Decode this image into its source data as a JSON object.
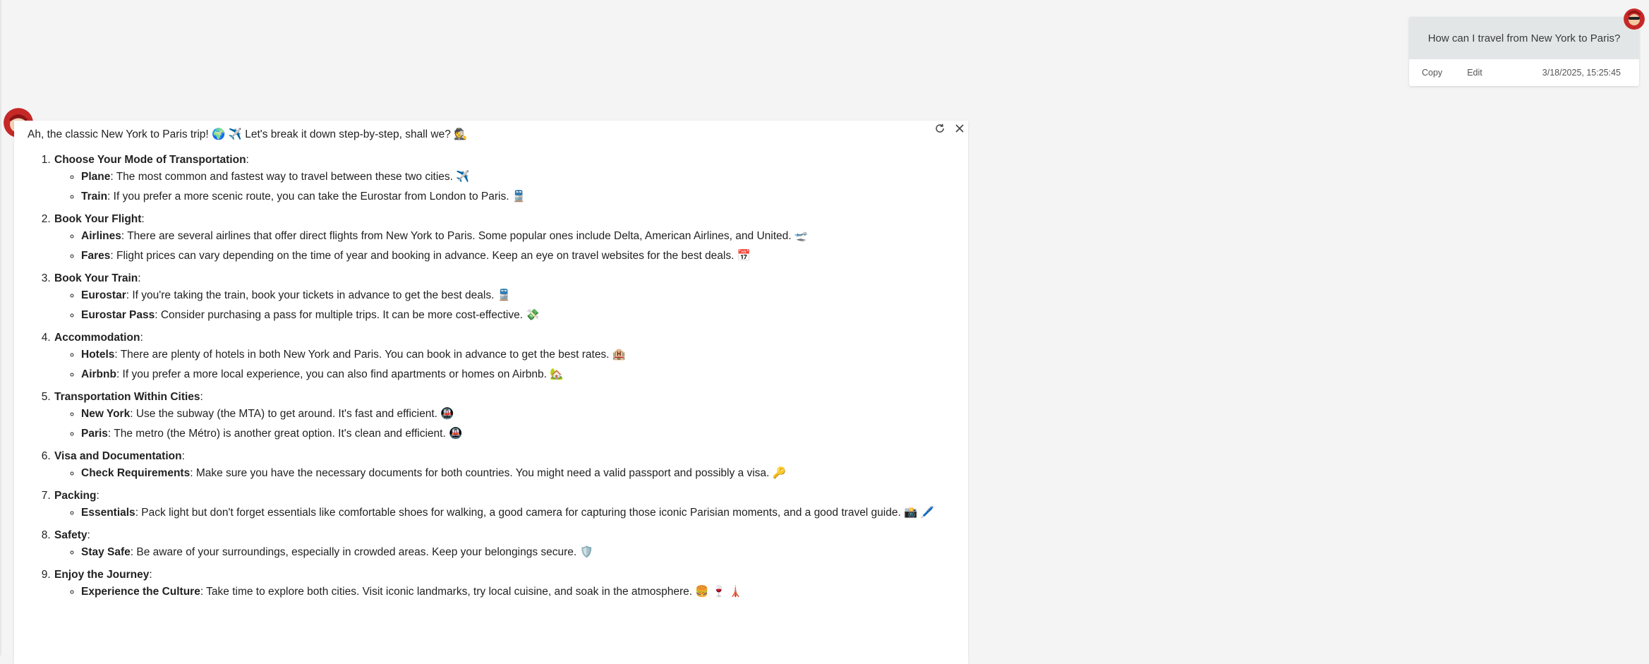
{
  "user_message": {
    "text": "How can I travel from New York to Paris?",
    "copy_label": "Copy",
    "edit_label": "Edit",
    "timestamp": "3/18/2025, 15:25:45"
  },
  "assistant": {
    "intro": "Ah, the classic New York to Paris trip! 🌍 ✈️ Let's break it down step-by-step, shall we? 🕵️",
    "steps": [
      {
        "title": "Choose Your Mode of Transportation",
        "items": [
          {
            "label": "Plane",
            "text": ": The most common and fastest way to travel between these two cities. ✈️"
          },
          {
            "label": "Train",
            "text": ": If you prefer a more scenic route, you can take the Eurostar from London to Paris. 🚆"
          }
        ]
      },
      {
        "title": "Book Your Flight",
        "items": [
          {
            "label": "Airlines",
            "text": ": There are several airlines that offer direct flights from New York to Paris. Some popular ones include Delta, American Airlines, and United. 🛫"
          },
          {
            "label": "Fares",
            "text": ": Flight prices can vary depending on the time of year and booking in advance. Keep an eye on travel websites for the best deals. 📅"
          }
        ]
      },
      {
        "title": "Book Your Train",
        "items": [
          {
            "label": "Eurostar",
            "text": ": If you're taking the train, book your tickets in advance to get the best deals. 🚆"
          },
          {
            "label": "Eurostar Pass",
            "text": ": Consider purchasing a pass for multiple trips. It can be more cost-effective. 💸"
          }
        ]
      },
      {
        "title": "Accommodation",
        "items": [
          {
            "label": "Hotels",
            "text": ": There are plenty of hotels in both New York and Paris. You can book in advance to get the best rates. 🏨"
          },
          {
            "label": "Airbnb",
            "text": ": If you prefer a more local experience, you can also find apartments or homes on Airbnb. 🏡"
          }
        ]
      },
      {
        "title": "Transportation Within Cities",
        "items": [
          {
            "label": "New York",
            "text": ": Use the subway (the MTA) to get around. It's fast and efficient. 🚇"
          },
          {
            "label": "Paris",
            "text": ": The metro (the Métro) is another great option. It's clean and efficient. 🚇"
          }
        ]
      },
      {
        "title": "Visa and Documentation",
        "items": [
          {
            "label": "Check Requirements",
            "text": ": Make sure you have the necessary documents for both countries. You might need a valid passport and possibly a visa. 🔑"
          }
        ]
      },
      {
        "title": "Packing",
        "items": [
          {
            "label": "Essentials",
            "text": ": Pack light but don't forget essentials like comfortable shoes for walking, a good camera for capturing those iconic Parisian moments, and a good travel guide. 📸 🖊️"
          }
        ]
      },
      {
        "title": "Safety",
        "items": [
          {
            "label": "Stay Safe",
            "text": ": Be aware of your surroundings, especially in crowded areas. Keep your belongings secure. 🛡️"
          }
        ]
      },
      {
        "title": "Enjoy the Journey",
        "items": [
          {
            "label": "Experience the Culture",
            "text": ": Take time to explore both cities. Visit iconic landmarks, try local cuisine, and soak in the atmosphere. 🍔 🍷 🗼"
          }
        ]
      }
    ]
  },
  "colors": {
    "page_background": "#f4f4f4",
    "user_bubble": "#e3e6e7",
    "avatar_red": "#c62828"
  },
  "icons": {
    "regenerate": "refresh-icon",
    "close": "close-icon",
    "user_avatar": "avatar-icon",
    "bot_avatar": "avatar-icon"
  }
}
